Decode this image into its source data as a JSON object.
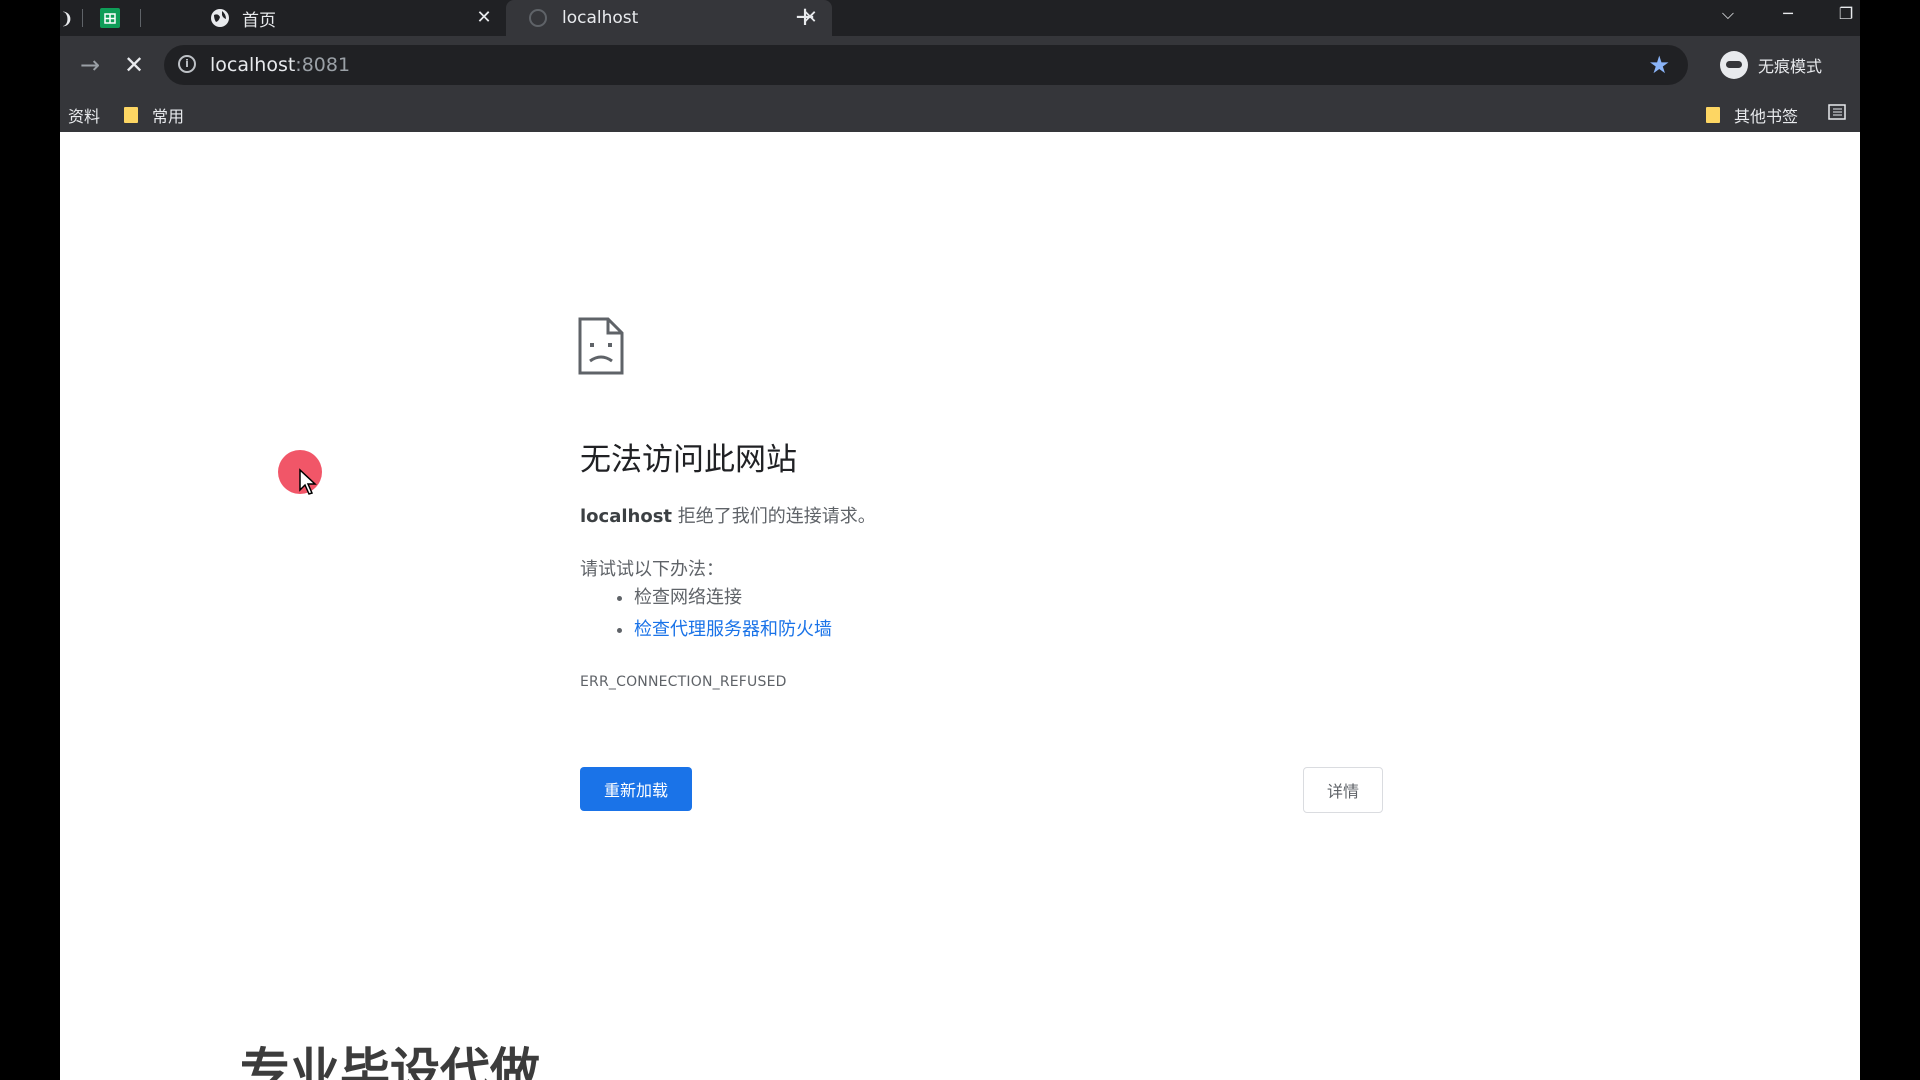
{
  "browser": {
    "tabs": [
      {
        "label": "首页",
        "active": false
      },
      {
        "label": "localhost",
        "active": true
      }
    ],
    "new_tab": "+",
    "url_host": "localhost",
    "url_port": ":8081",
    "profile_label": "无痕模式",
    "bookmarks": {
      "left": [
        {
          "label": "资料"
        },
        {
          "label": "常用"
        }
      ],
      "right": [
        {
          "label": "其他书签"
        }
      ]
    }
  },
  "error_page": {
    "title": "无法访问此网站",
    "host": "localhost",
    "message": " 拒绝了我们的连接请求。",
    "try_label": "请试试以下办法：",
    "suggestions": [
      {
        "text": "检查网络连接",
        "is_link": false
      },
      {
        "text": "检查代理服务器和防火墙",
        "is_link": true
      }
    ],
    "error_code": "ERR_CONNECTION_REFUSED",
    "reload_button": "重新加载",
    "details_button": "详情"
  },
  "background_text": "专业毕设代做",
  "colors": {
    "accent": "#1a73e8",
    "cursor_highlight": "#ef4458"
  }
}
